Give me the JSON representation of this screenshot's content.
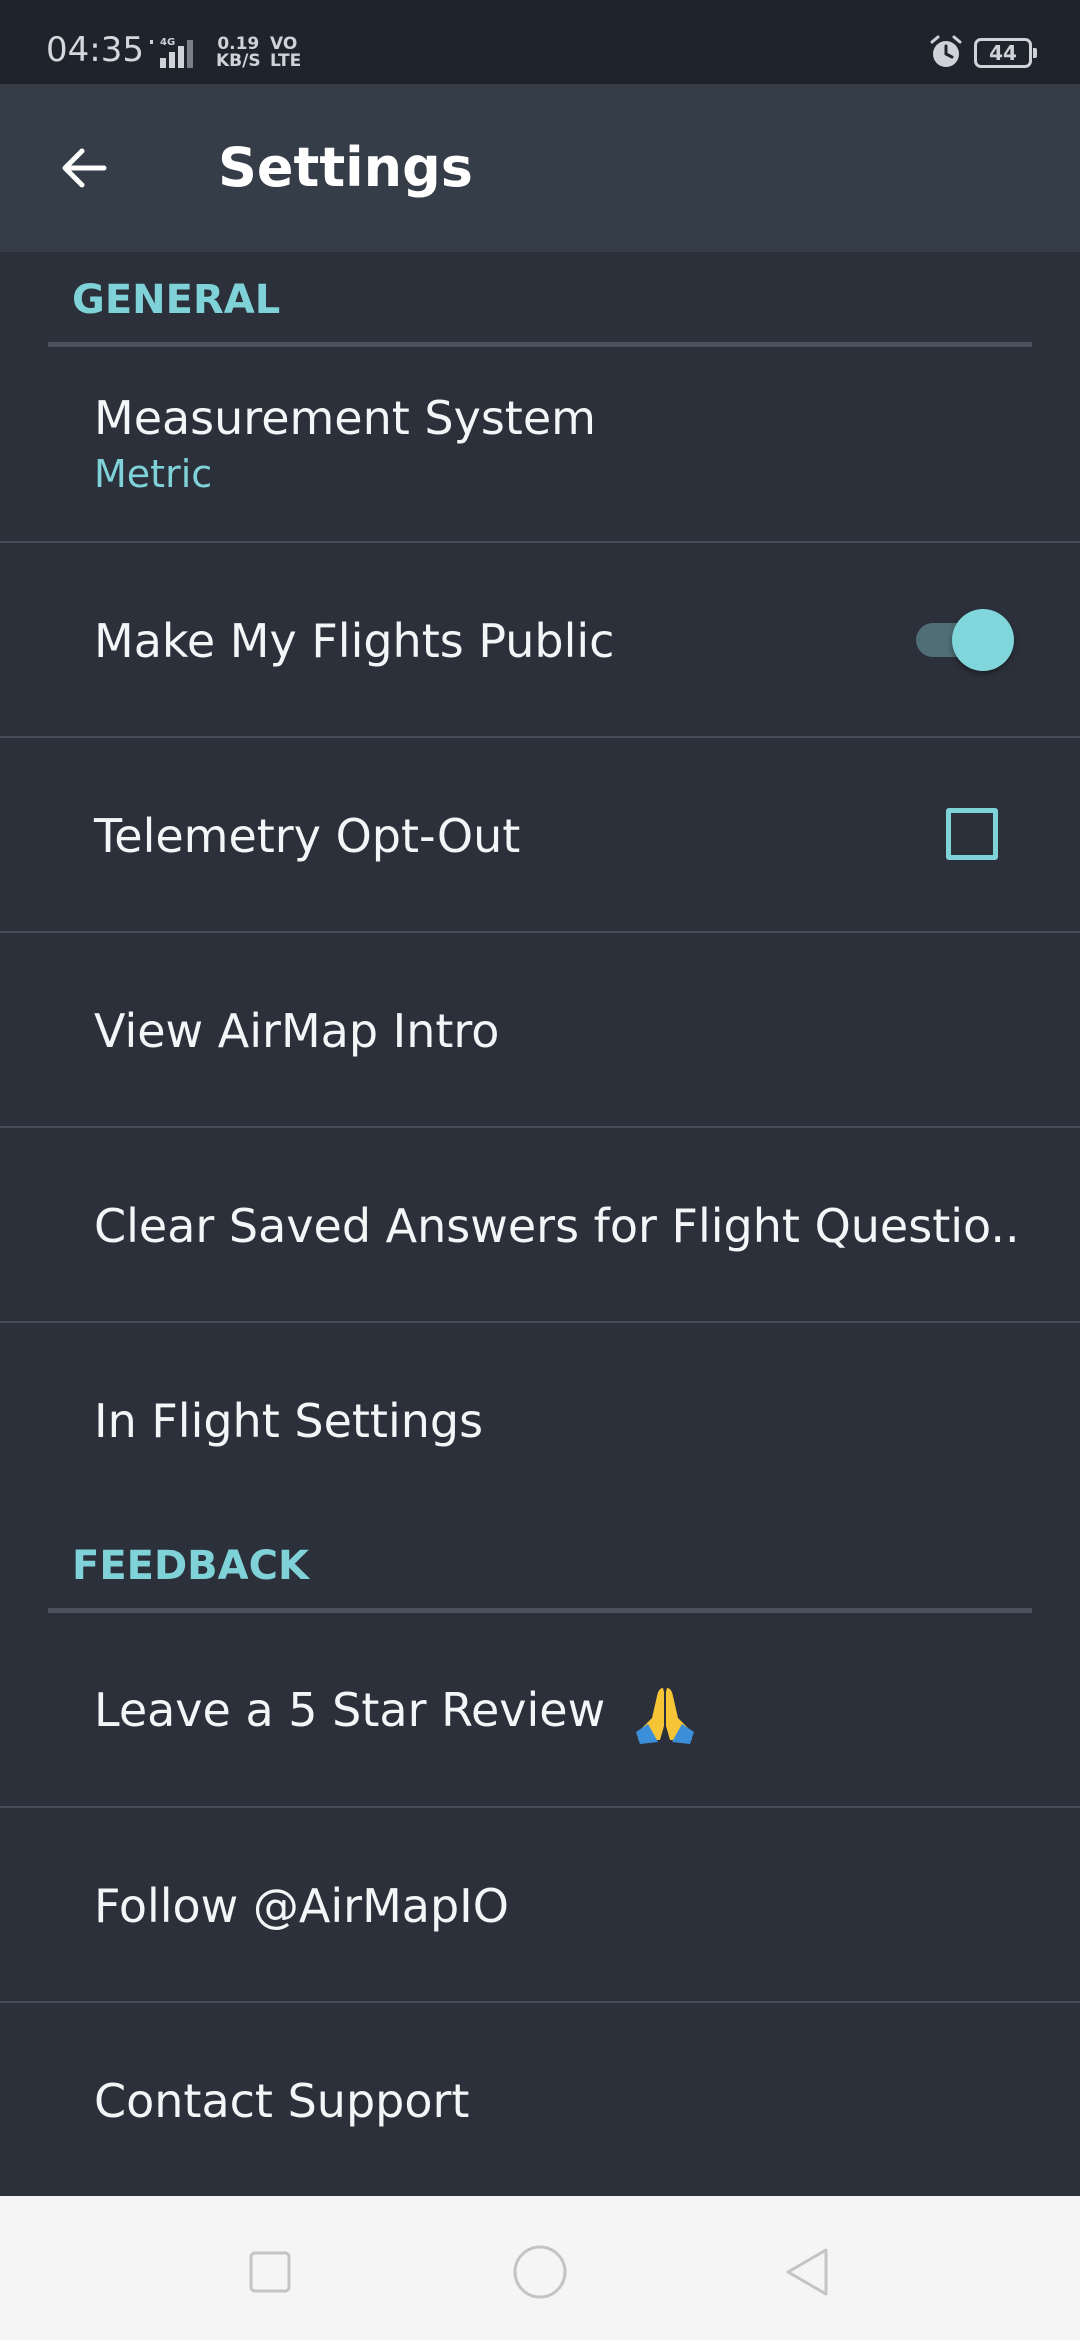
{
  "status_bar": {
    "time": "04:35",
    "network": "4G",
    "speed_value": "0.19",
    "speed_unit": "KB/S",
    "volte_top": "VO",
    "volte_bottom": "LTE",
    "battery": "44",
    "icons": [
      "signal-icon",
      "alarm-icon",
      "battery-icon"
    ]
  },
  "app_bar": {
    "title": "Settings",
    "back_icon": "arrow-back-icon"
  },
  "sections": {
    "general": {
      "label": "GENERAL",
      "rows": {
        "measurement": {
          "title": "Measurement System",
          "value": "Metric"
        },
        "public_flights": {
          "title": "Make My Flights Public",
          "toggle_on": true
        },
        "telemetry": {
          "title": "Telemetry Opt-Out",
          "checked": false
        },
        "intro": {
          "title": "View AirMap Intro"
        },
        "clear_answers": {
          "title": "Clear Saved Answers for Flight Questio.."
        },
        "in_flight": {
          "title": "In Flight Settings"
        }
      }
    },
    "feedback": {
      "label": "FEEDBACK",
      "rows": {
        "review": {
          "title": "Leave a 5 Star Review",
          "emoji": "folded-hands-icon"
        },
        "follow": {
          "title": "Follow @AirMapIO"
        },
        "support": {
          "title": "Contact Support"
        }
      }
    }
  },
  "nav_bar": {
    "icons": [
      "recents-square-icon",
      "home-circle-icon",
      "back-triangle-icon"
    ]
  },
  "colors": {
    "background": "#2b303b",
    "app_bar": "#353e48",
    "status_bar": "#1f232b",
    "accent": "#7fd3d8",
    "text": "#f4f5f7",
    "divider": "#454c58",
    "nav_bar": "#f5f5f5"
  }
}
